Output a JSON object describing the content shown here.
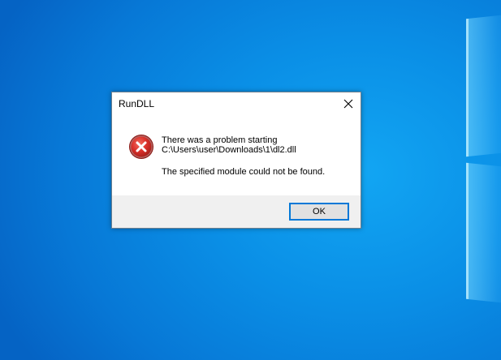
{
  "dialog": {
    "title": "RunDLL",
    "message_line1": "There was a problem starting",
    "message_line2": "C:\\Users\\user\\Downloads\\1\\dl2.dll",
    "message_line3": "The specified module could not be found.",
    "ok_label": "OK",
    "icon": "error-icon",
    "accent_color": "#0078d7",
    "error_color": "#c42b1c"
  }
}
